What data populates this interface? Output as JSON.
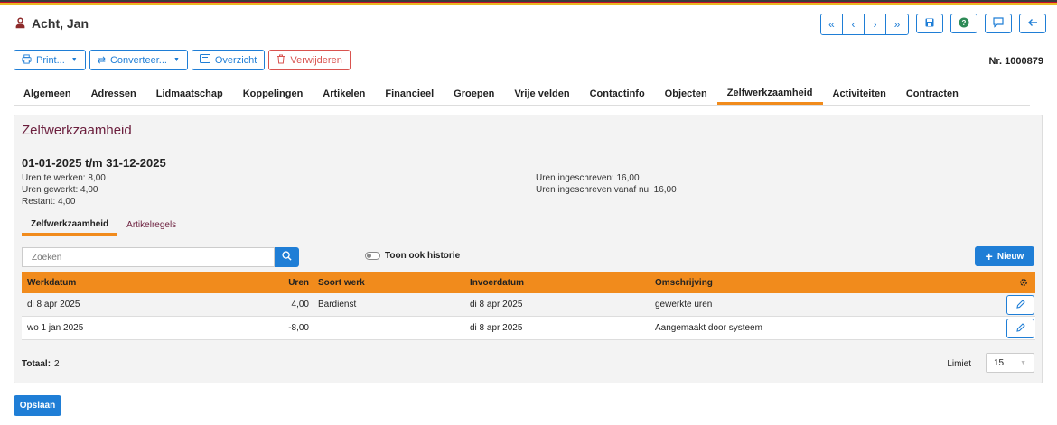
{
  "header": {
    "title": "Acht, Jan"
  },
  "toolbar": {
    "print_label": "Print...",
    "convert_label": "Converteer...",
    "overview_label": "Overzicht",
    "delete_label": "Verwijderen",
    "record_number": "Nr. 1000879"
  },
  "tabs": [
    "Algemeen",
    "Adressen",
    "Lidmaatschap",
    "Koppelingen",
    "Artikelen",
    "Financieel",
    "Groepen",
    "Vrije velden",
    "Contactinfo",
    "Objecten",
    "Zelfwerkzaamheid",
    "Activiteiten",
    "Contracten"
  ],
  "active_tab": "Zelfwerkzaamheid",
  "panel": {
    "title": "Zelfwerkzaamheid",
    "period": "01-01-2025 t/m 31-12-2025",
    "left_info": [
      "Uren te werken: 8,00",
      "Uren gewerkt: 4,00",
      "Restant: 4,00"
    ],
    "right_info": [
      "Uren ingeschreven: 16,00",
      "Uren ingeschreven vanaf nu: 16,00"
    ],
    "subtabs": [
      "Zelfwerkzaamheid",
      "Artikelregels"
    ],
    "search_placeholder": "Zoeken",
    "history_label": "Toon ook historie",
    "new_label": "Nieuw",
    "table": {
      "columns": [
        "Werkdatum",
        "Uren",
        "Soort werk",
        "Invoerdatum",
        "Omschrijving"
      ],
      "rows": [
        [
          "di 8 apr 2025",
          "4,00",
          "Bardienst",
          "di 8 apr 2025",
          "gewerkte uren"
        ],
        [
          "wo 1 jan 2025",
          "-8,00",
          "",
          "di 8 apr 2025",
          "Aangemaakt door systeem"
        ]
      ]
    },
    "total_label": "Totaal:",
    "total_value": "2",
    "limit_label": "Limiet",
    "limit_value": "15"
  },
  "save_label": "Opslaan",
  "colors": {
    "accent": "#1f7ed6",
    "orange": "#f18b1c",
    "maroon": "#6b1e3d",
    "danger": "#d9534f"
  },
  "icons": [
    "user-icon",
    "first-icon",
    "prev-icon",
    "next-icon",
    "last-icon",
    "save-icon",
    "help-icon",
    "comment-icon",
    "back-icon",
    "print-icon",
    "convert-icon",
    "overview-icon",
    "trash-icon",
    "search-icon",
    "plus-icon",
    "gear-icon",
    "pencil-icon"
  ]
}
